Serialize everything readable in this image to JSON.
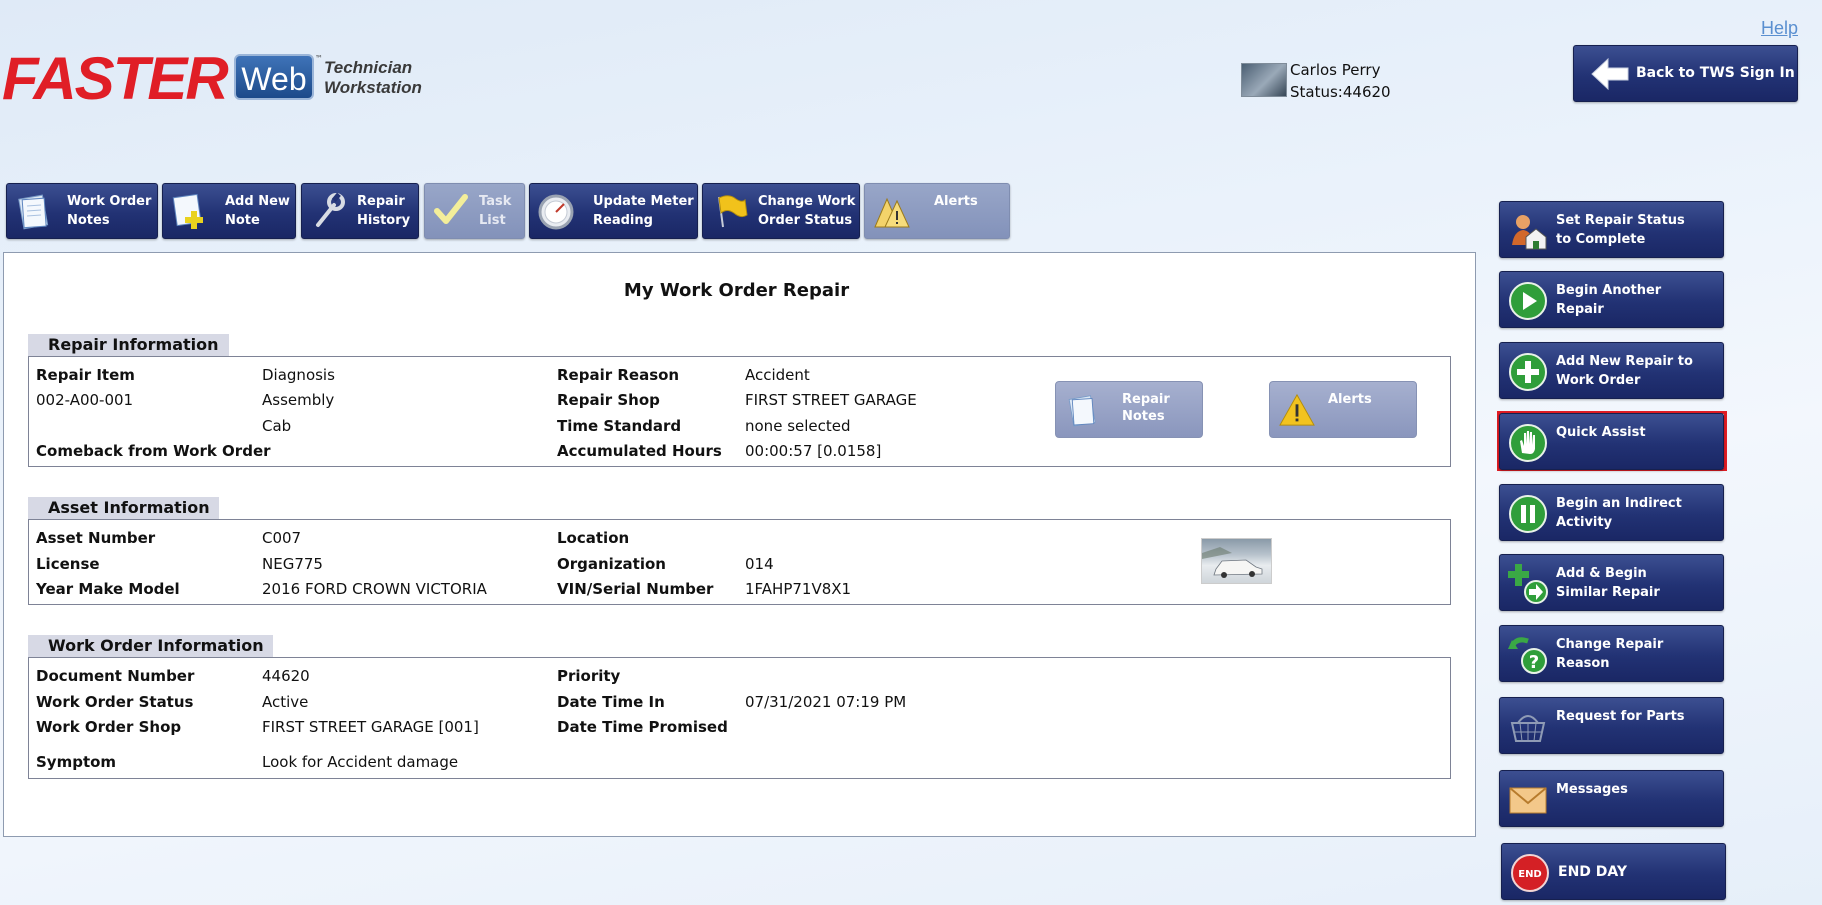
{
  "header": {
    "logo_faster": "FASTER",
    "logo_web": "Web",
    "logo_tm": "™",
    "logo_sub_line1": "Technician",
    "logo_sub_line2": "Workstation",
    "help": "Help",
    "user_name": "Carlos Perry",
    "user_status": "Status:44620",
    "back_button": "Back to TWS Sign In"
  },
  "toolbar": [
    {
      "line1": "Work Order",
      "line2": "Notes",
      "icon": "notepad-icon",
      "enabled": true
    },
    {
      "line1": "Add New",
      "line2": "Note",
      "icon": "add-note-icon",
      "enabled": true
    },
    {
      "line1": "Repair",
      "line2": "History",
      "icon": "wrench-icon",
      "enabled": true
    },
    {
      "line1": "Task",
      "line2": "List",
      "icon": "checkmark-icon",
      "enabled": false
    },
    {
      "line1": "Update Meter",
      "line2": "Reading",
      "icon": "meter-icon",
      "enabled": true
    },
    {
      "line1": "Change Work",
      "line2": "Order Status",
      "icon": "flag-icon",
      "enabled": true
    },
    {
      "line1": "Alerts",
      "line2": "",
      "icon": "alert-triangles-icon",
      "enabled": false
    }
  ],
  "page_title": "My Work Order Repair",
  "repair": {
    "section_title": "Repair Information",
    "repair_item_label": "Repair Item",
    "repair_item_code": "002-A00-001",
    "repair_item_line1": "Diagnosis",
    "repair_item_line2": "Assembly",
    "repair_item_line3": "Cab",
    "comeback_label": "Comeback from Work Order",
    "reason_label": "Repair Reason",
    "reason_value": "Accident",
    "shop_label": "Repair Shop",
    "shop_value": "FIRST STREET GARAGE",
    "time_label": "Time Standard",
    "time_value": "none selected",
    "hours_label": "Accumulated Hours",
    "hours_value": "00:00:57 [0.0158]",
    "repair_notes_line1": "Repair",
    "repair_notes_line2": "Notes",
    "alerts_button": "Alerts"
  },
  "asset": {
    "section_title": "Asset Information",
    "number_label": "Asset Number",
    "number_value": "C007",
    "license_label": "License",
    "license_value": "NEG775",
    "ymm_label": "Year Make Model",
    "ymm_value": "2016 FORD CROWN VICTORIA",
    "location_label": "Location",
    "org_label": "Organization",
    "org_value": "014",
    "vin_label": "VIN/Serial Number",
    "vin_value": "1FAHP71V8X1"
  },
  "work_order": {
    "section_title": "Work Order Information",
    "doc_label": "Document Number",
    "doc_value": "44620",
    "status_label": "Work Order Status",
    "status_value": "Active",
    "shop_label": "Work Order Shop",
    "shop_value": "FIRST STREET GARAGE [001]",
    "symptom_label": "Symptom",
    "symptom_value": "Look for Accident damage",
    "priority_label": "Priority",
    "date_in_label": "Date Time In",
    "date_in_value": "07/31/2021 07:19 PM",
    "promised_label": "Date Time Promised"
  },
  "side_actions": [
    {
      "line1": "Set Repair Status",
      "line2": "to Complete",
      "icon": "person-house-icon"
    },
    {
      "line1": "Begin Another",
      "line2": "Repair",
      "icon": "play-icon"
    },
    {
      "line1": "Add New Repair to",
      "line2": "Work Order",
      "icon": "plus-icon"
    },
    {
      "line1": "Quick Assist",
      "line2": "",
      "icon": "hand-icon"
    },
    {
      "line1": "Begin an Indirect",
      "line2": "Activity",
      "icon": "pause-icon"
    },
    {
      "line1": "Add & Begin",
      "line2": "Similar Repair",
      "icon": "plus-arrow-icon"
    },
    {
      "line1": "Change Repair",
      "line2": "Reason",
      "icon": "question-icon"
    },
    {
      "line1": "Request for Parts",
      "line2": "",
      "icon": "basket-icon"
    },
    {
      "line1": "Messages",
      "line2": "",
      "icon": "envelope-icon"
    },
    {
      "line1": "END DAY",
      "line2": "",
      "icon": "end-icon"
    }
  ],
  "colors": {
    "accent_red": "#e01c24",
    "navy": "#223274"
  }
}
